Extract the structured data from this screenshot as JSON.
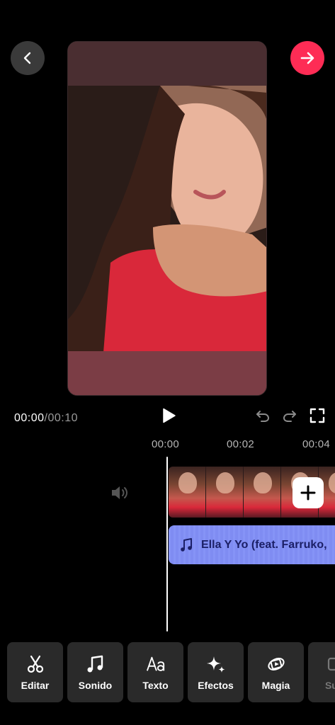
{
  "header": {
    "back_icon": "chevron-left-icon",
    "next_icon": "arrow-right-icon",
    "accent": "#fe2c55"
  },
  "playback": {
    "current_time": "00:00",
    "separator": "/",
    "total_time": "00:10"
  },
  "ruler": [
    "00:00",
    "00:02",
    "00:04"
  ],
  "timeline": {
    "audio_title": "Ella Y Yo (feat. Farruko,",
    "audio_color": "#7f8cf2"
  },
  "toolbar": [
    {
      "label": "Editar",
      "icon": "scissors-icon"
    },
    {
      "label": "Sonido",
      "icon": "music-note-icon"
    },
    {
      "label": "Texto",
      "icon": "text-aa-icon"
    },
    {
      "label": "Efectos",
      "icon": "sparkles-icon"
    },
    {
      "label": "Magia",
      "icon": "magic-icon"
    },
    {
      "label": "Subt",
      "icon": "captions-icon"
    }
  ]
}
